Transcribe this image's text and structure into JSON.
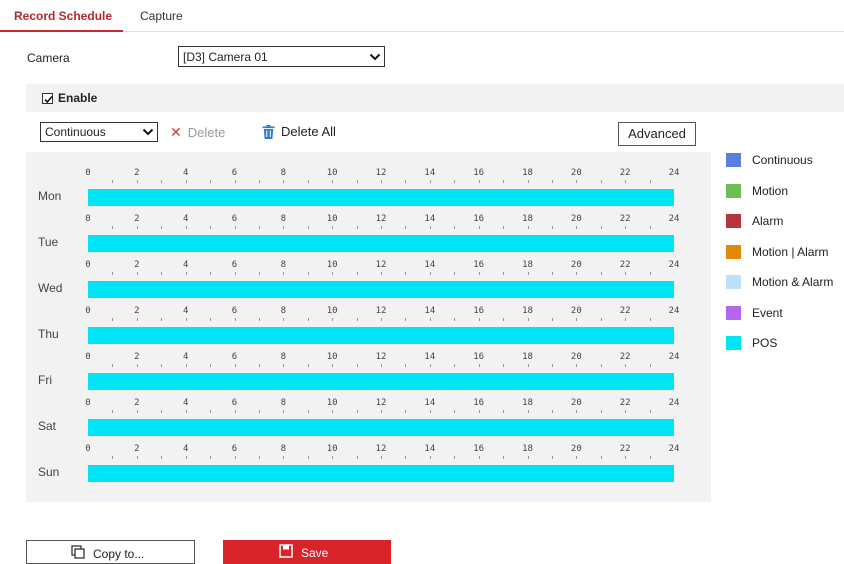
{
  "tabs": [
    {
      "label": "Record Schedule",
      "active": true
    },
    {
      "label": "Capture",
      "active": false
    }
  ],
  "camera": {
    "label": "Camera",
    "selected": "[D3] Camera 01"
  },
  "enable": {
    "label": "Enable",
    "checked": true
  },
  "toolbar": {
    "type_selected": "Continuous",
    "delete_label": "Delete",
    "delete_all_label": "Delete All",
    "advanced_label": "Advanced"
  },
  "schedule": {
    "hour_ticks": [
      "0",
      "2",
      "4",
      "6",
      "8",
      "10",
      "12",
      "14",
      "16",
      "18",
      "20",
      "22",
      "24"
    ],
    "days": [
      {
        "label": "Mon",
        "type": "POS",
        "start": 0,
        "end": 24
      },
      {
        "label": "Tue",
        "type": "POS",
        "start": 0,
        "end": 24
      },
      {
        "label": "Wed",
        "type": "POS",
        "start": 0,
        "end": 24
      },
      {
        "label": "Thu",
        "type": "POS",
        "start": 0,
        "end": 24
      },
      {
        "label": "Fri",
        "type": "POS",
        "start": 0,
        "end": 24
      },
      {
        "label": "Sat",
        "type": "POS",
        "start": 0,
        "end": 24
      },
      {
        "label": "Sun",
        "type": "POS",
        "start": 0,
        "end": 24
      }
    ]
  },
  "legend": [
    {
      "label": "Continuous",
      "color": "#5b7fe0"
    },
    {
      "label": "Motion",
      "color": "#6cbf56"
    },
    {
      "label": "Alarm",
      "color": "#b8343c"
    },
    {
      "label": "Motion | Alarm",
      "color": "#e08a0a"
    },
    {
      "label": "Motion & Alarm",
      "color": "#bfe0f7"
    },
    {
      "label": "Event",
      "color": "#b565ee"
    },
    {
      "label": "POS",
      "color": "#00e5f5"
    }
  ],
  "footer": {
    "copy_label": "Copy to...",
    "save_label": "Save"
  },
  "colors": {
    "accent": "#c8282e",
    "pos_bar": "#00e5f5",
    "panel_bg": "#f2f2f2"
  }
}
